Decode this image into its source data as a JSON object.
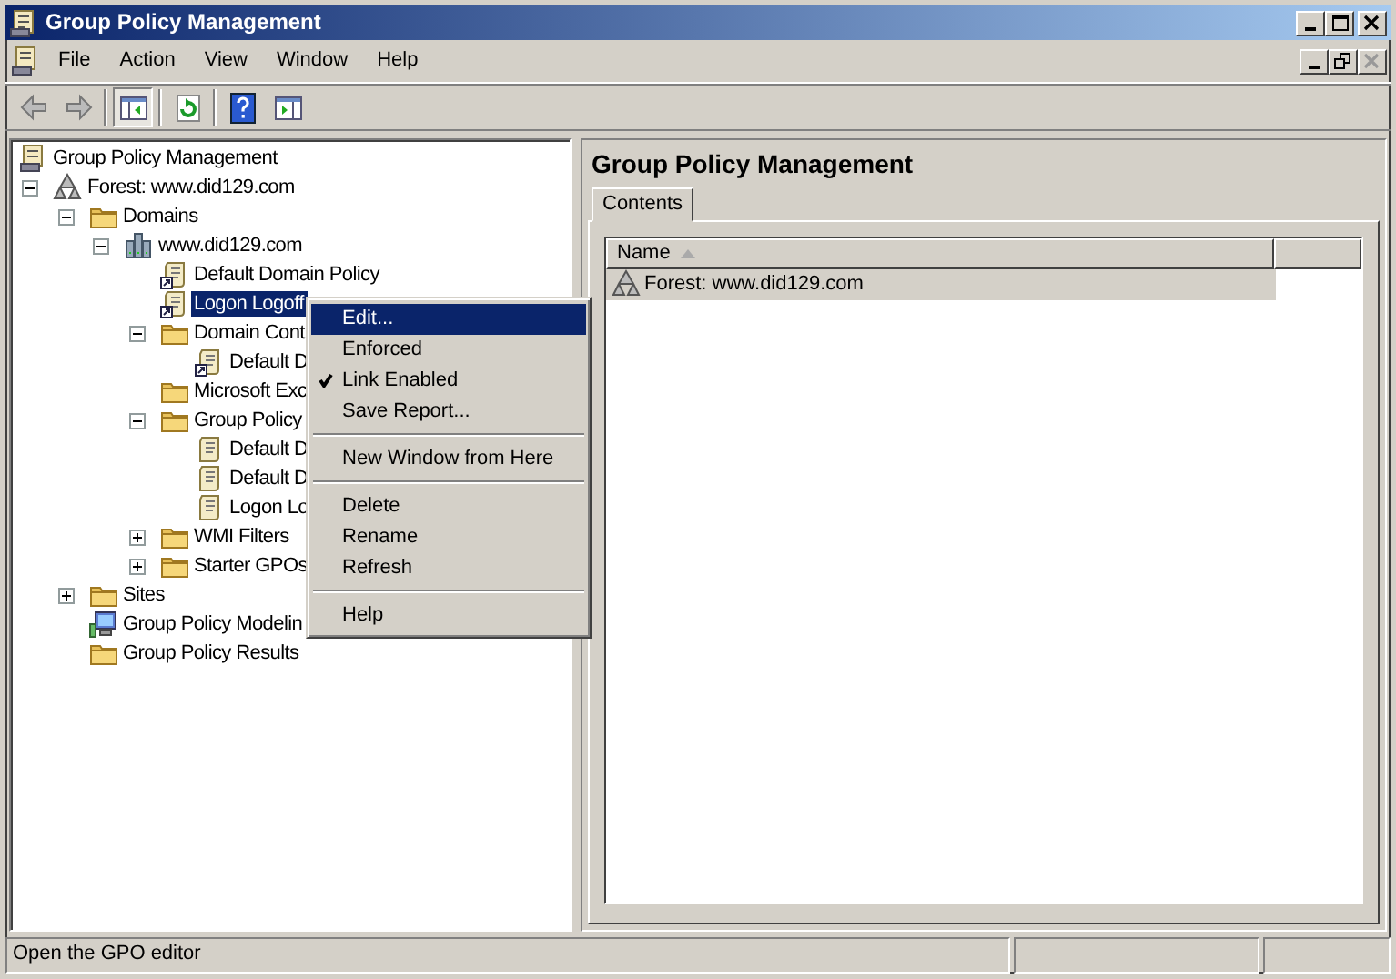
{
  "window": {
    "title": "Group Policy Management"
  },
  "menu_bar": [
    {
      "label": "File"
    },
    {
      "label": "Action"
    },
    {
      "label": "View"
    },
    {
      "label": "Window"
    },
    {
      "label": "Help"
    }
  ],
  "toolbar": [
    {
      "kind": "back",
      "pressed": false
    },
    {
      "kind": "forward",
      "pressed": false
    },
    {
      "kind": "tree-toggle",
      "pressed": true
    },
    {
      "kind": "refresh",
      "pressed": false
    },
    {
      "kind": "help",
      "pressed": false
    },
    {
      "kind": "action-pane",
      "pressed": false
    }
  ],
  "tree": {
    "items": [
      {
        "label": "Group Policy Management",
        "kind": "console",
        "selected": false,
        "children": [
          {
            "label": "Forest: www.did129.com",
            "kind": "forest",
            "expanded": true,
            "selected": false,
            "children": [
              {
                "label": "Domains",
                "kind": "folder",
                "expanded": true,
                "selected": false,
                "children": [
                  {
                    "label": "www.did129.com",
                    "kind": "domain",
                    "expanded": true,
                    "selected": false,
                    "children": [
                      {
                        "label": "Default Domain Policy",
                        "kind": "gpo-link",
                        "selected": false
                      },
                      {
                        "label": "Logon Logoff",
                        "kind": "gpo-link",
                        "selected": true
                      },
                      {
                        "label": "Domain Cont",
                        "kind": "folder",
                        "expanded": true,
                        "selected": false,
                        "children": [
                          {
                            "label": "Default D",
                            "kind": "gpo-link",
                            "selected": false
                          }
                        ]
                      },
                      {
                        "label": "Microsoft Exc",
                        "kind": "folder",
                        "selected": false
                      },
                      {
                        "label": "Group Policy",
                        "kind": "folder",
                        "expanded": true,
                        "selected": false,
                        "children": [
                          {
                            "label": "Default D",
                            "kind": "gpo",
                            "selected": false
                          },
                          {
                            "label": "Default D",
                            "kind": "gpo",
                            "selected": false
                          },
                          {
                            "label": "Logon Lo",
                            "kind": "gpo",
                            "selected": false
                          }
                        ]
                      },
                      {
                        "label": "WMI Filters",
                        "kind": "folder",
                        "expanded": false,
                        "selected": false
                      },
                      {
                        "label": "Starter GPOs",
                        "kind": "folder",
                        "expanded": false,
                        "selected": false
                      }
                    ]
                  }
                ]
              },
              {
                "label": "Sites",
                "kind": "folder",
                "expanded": false,
                "selected": false
              },
              {
                "label": "Group Policy Modelin",
                "kind": "computer",
                "selected": false
              },
              {
                "label": "Group Policy Results",
                "kind": "folder",
                "selected": false
              }
            ]
          }
        ]
      }
    ]
  },
  "context_menu": {
    "items": [
      {
        "kind": "item",
        "label": "Edit...",
        "selected": true,
        "checked": false
      },
      {
        "kind": "item",
        "label": "Enforced",
        "selected": false,
        "checked": false
      },
      {
        "kind": "item",
        "label": "Link Enabled",
        "selected": false,
        "checked": true
      },
      {
        "kind": "item",
        "label": "Save Report...",
        "selected": false,
        "checked": false
      },
      {
        "kind": "separator"
      },
      {
        "kind": "item",
        "label": "New Window from Here",
        "selected": false,
        "checked": false
      },
      {
        "kind": "separator"
      },
      {
        "kind": "item",
        "label": "Delete",
        "selected": false,
        "checked": false
      },
      {
        "kind": "item",
        "label": "Rename",
        "selected": false,
        "checked": false
      },
      {
        "kind": "item",
        "label": "Refresh",
        "selected": false,
        "checked": false
      },
      {
        "kind": "separator"
      },
      {
        "kind": "item",
        "label": "Help",
        "selected": false,
        "checked": false
      }
    ]
  },
  "details": {
    "title": "Group Policy Management",
    "tabs": [
      {
        "label": "Contents",
        "selected": true
      }
    ],
    "columns": [
      {
        "label": "Name",
        "sorted": true
      }
    ],
    "rows": [
      {
        "name": "Forest: www.did129.com",
        "selected": true
      }
    ]
  },
  "status_bar": {
    "text": "Open the GPO editor"
  }
}
